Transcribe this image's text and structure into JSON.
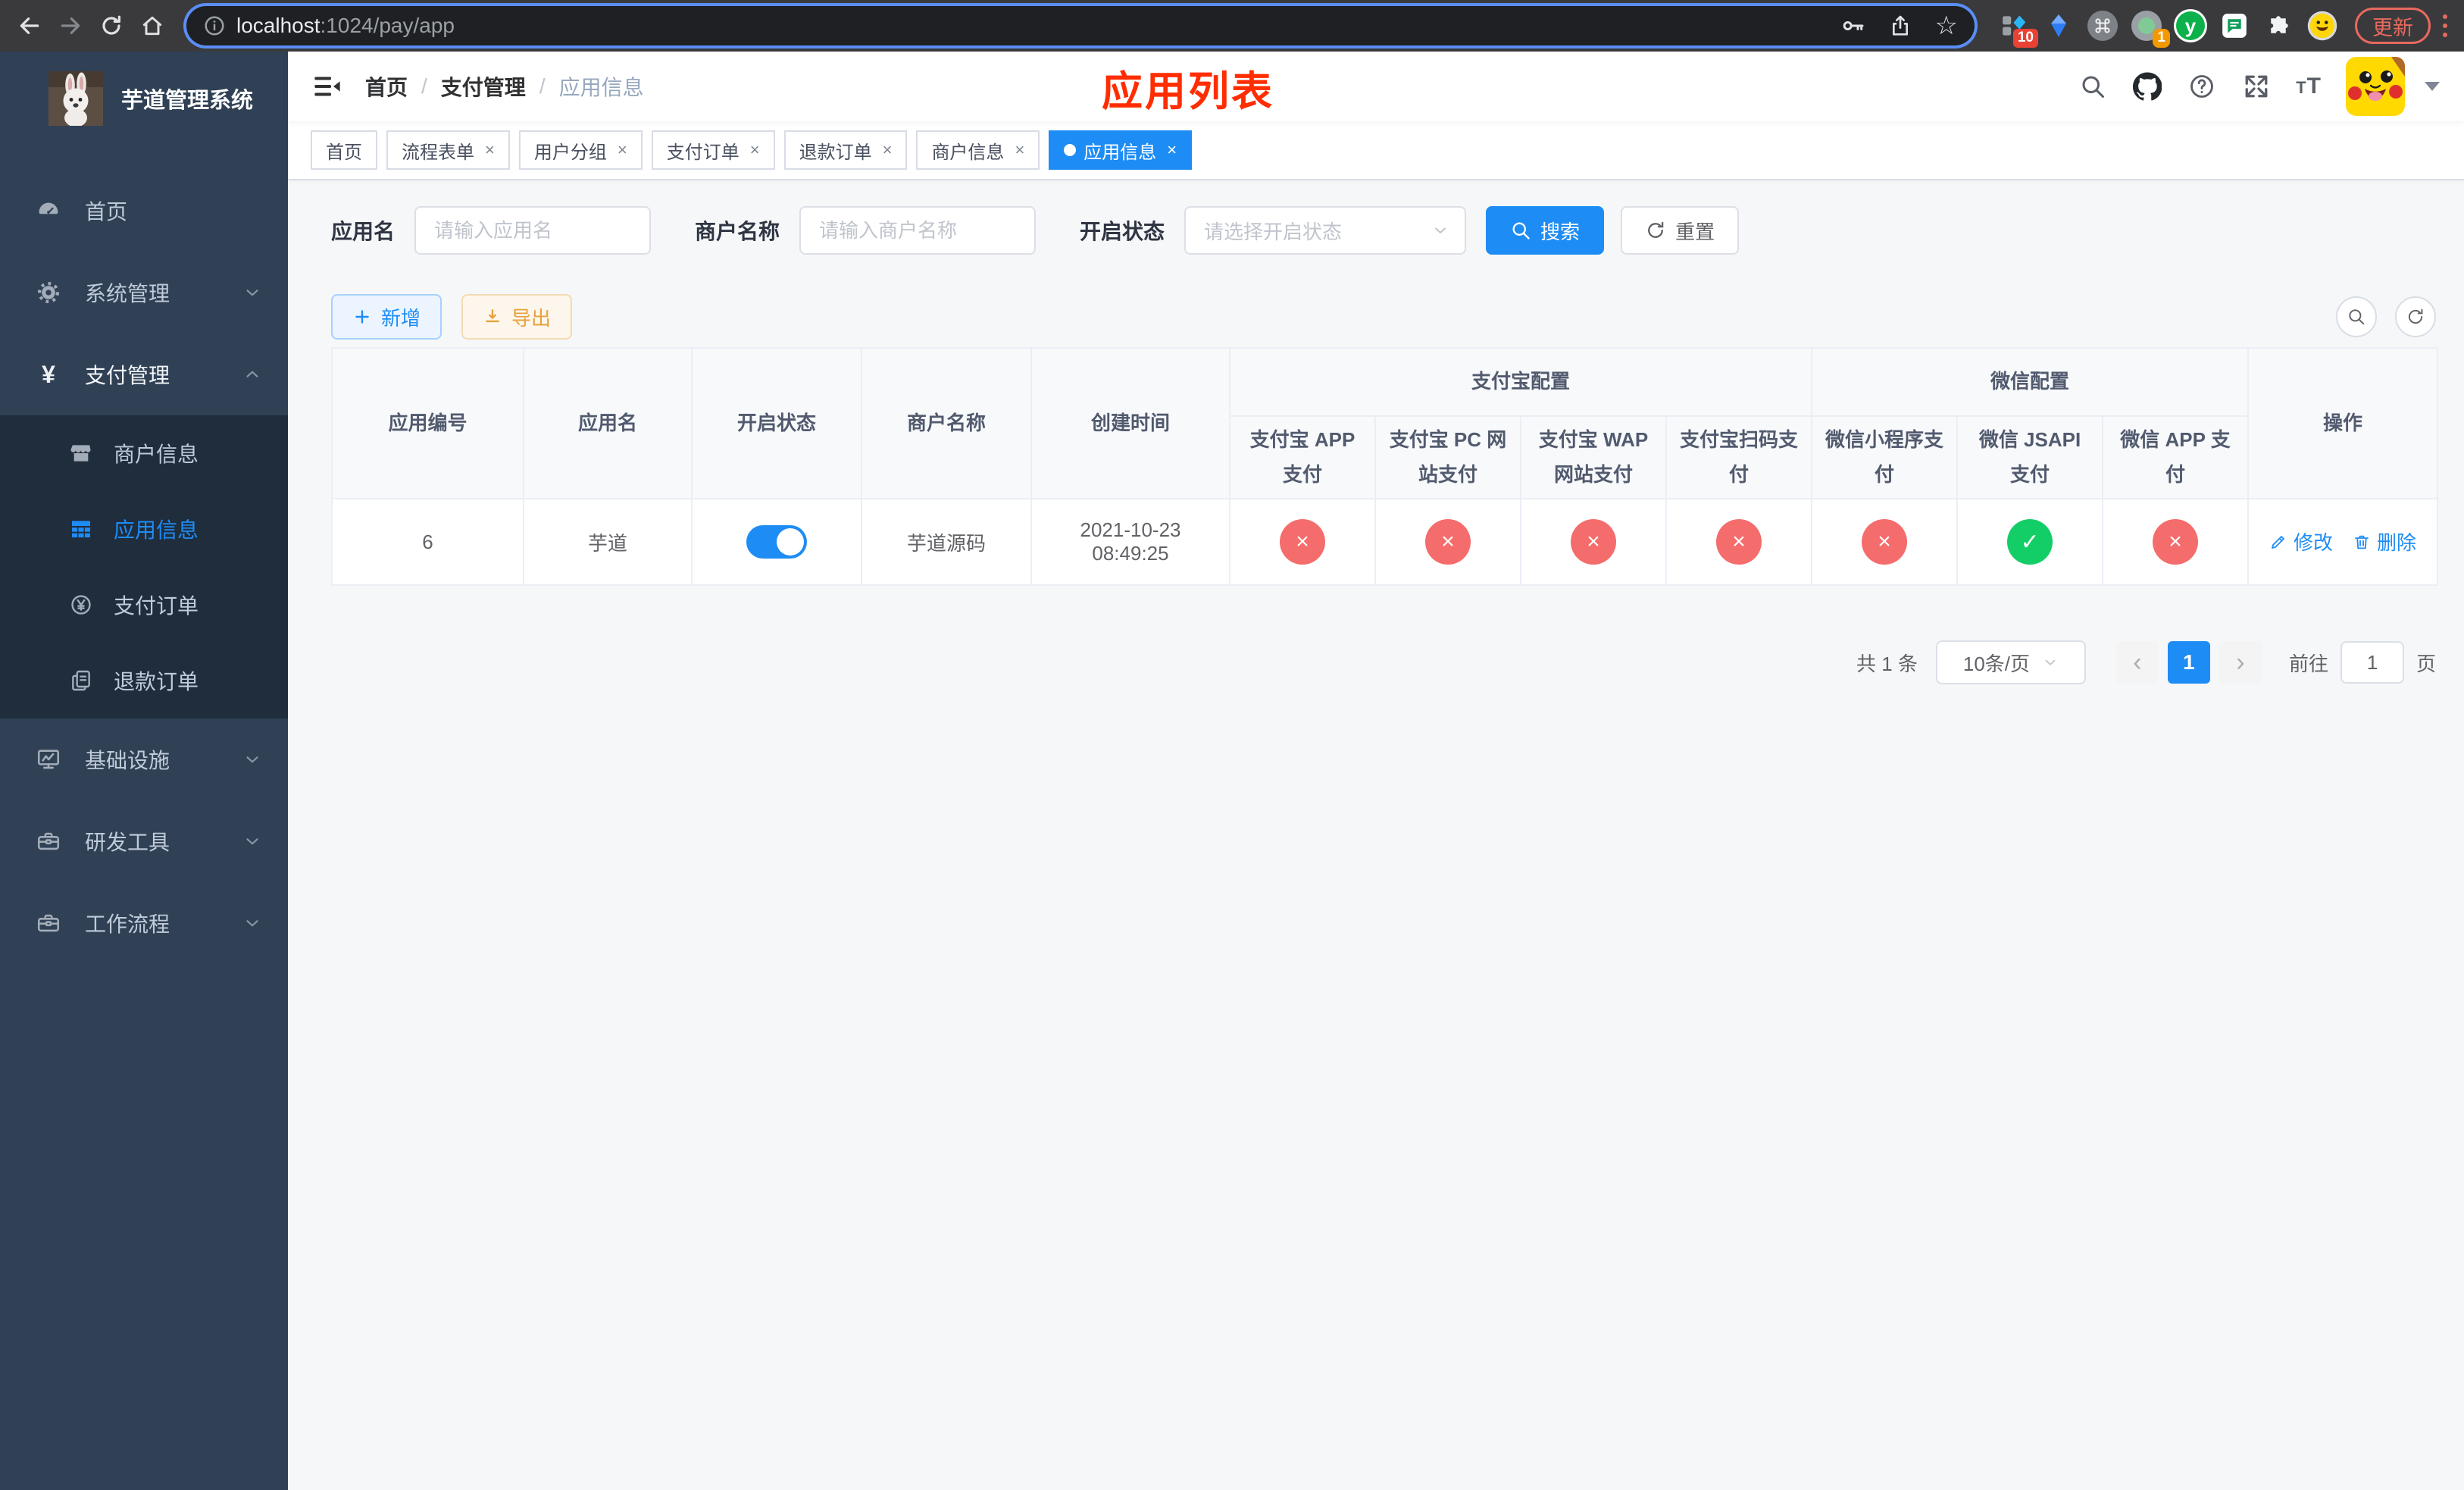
{
  "colors": {
    "accent": "#1e8cf5",
    "danger": "#f56c6c",
    "success": "#13ce66",
    "warning": "#e6a23c",
    "annotation_red": "#ff2d00",
    "sidebar_bg": "#304156",
    "sidebar_sub_bg": "#1f2d3d"
  },
  "browser": {
    "url_host": "localhost",
    "url_path": ":1024/pay/app",
    "update_label": "更新",
    "ext_badge_pin": "10",
    "ext_badge_profile": "1"
  },
  "sidebar": {
    "title": "芋道管理系统",
    "items": [
      {
        "label": "首页"
      },
      {
        "label": "系统管理"
      },
      {
        "label": "支付管理"
      },
      {
        "label": "基础设施"
      },
      {
        "label": "研发工具"
      },
      {
        "label": "工作流程"
      }
    ],
    "sub_items": [
      {
        "label": "商户信息"
      },
      {
        "label": "应用信息"
      },
      {
        "label": "支付订单"
      },
      {
        "label": "退款订单"
      }
    ]
  },
  "header": {
    "breadcrumb": [
      "首页",
      "支付管理",
      "应用信息"
    ],
    "separator": "/",
    "annotation": "应用列表"
  },
  "tabs": [
    {
      "label": "首页"
    },
    {
      "label": "流程表单"
    },
    {
      "label": "用户分组"
    },
    {
      "label": "支付订单"
    },
    {
      "label": "退款订单"
    },
    {
      "label": "商户信息"
    },
    {
      "label": "应用信息"
    }
  ],
  "tab_close_glyph": "×",
  "filters": {
    "app_name": {
      "label": "应用名",
      "placeholder": "请输入应用名"
    },
    "merchant_name": {
      "label": "商户名称",
      "placeholder": "请输入商户名称"
    },
    "status": {
      "label": "开启状态",
      "placeholder": "请选择开启状态"
    },
    "search_label": "搜索",
    "reset_label": "重置"
  },
  "toolbar": {
    "add_label": "新增",
    "export_label": "导出"
  },
  "table": {
    "columns": [
      "应用编号",
      "应用名",
      "开启状态",
      "商户名称",
      "创建时间"
    ],
    "groups": [
      {
        "title": "支付宝配置",
        "children": [
          "支付宝 APP 支付",
          "支付宝 PC 网站支付",
          "支付宝 WAP 网站支付",
          "支付宝扫码支付"
        ]
      },
      {
        "title": "微信配置",
        "children": [
          "微信小程序支付",
          "微信 JSAPI 支付",
          "微信 APP 支付"
        ]
      }
    ],
    "action_col": "操作",
    "row": {
      "id": "6",
      "name": "芋道",
      "enabled": true,
      "merchant": "芋道源码",
      "created": "2021-10-23 08:49:25",
      "pay_status": [
        false,
        false,
        false,
        false,
        false,
        true,
        false
      ],
      "edit_label": "修改",
      "delete_label": "删除"
    }
  },
  "pagination": {
    "total": "共 1 条",
    "page_size": "10条/页",
    "page": "1",
    "prev_glyph": "‹",
    "next_glyph": "›",
    "goto_label": "前往",
    "goto_value": "1",
    "unit_label": "页"
  }
}
